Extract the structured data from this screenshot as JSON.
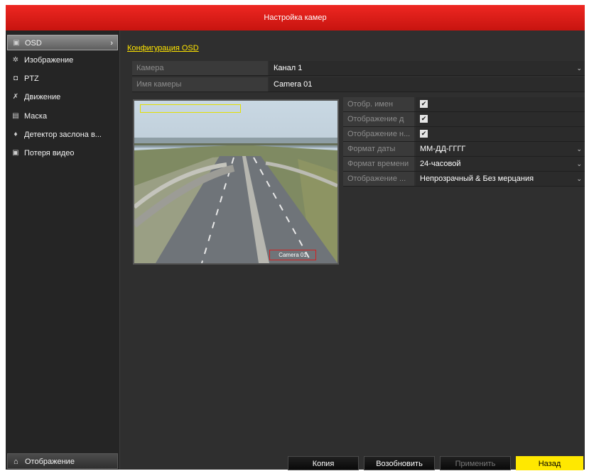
{
  "window": {
    "title": "Настройка камер"
  },
  "sidebar": {
    "items": [
      {
        "label": "OSD",
        "icon": "osd-icon",
        "glyph": "▣",
        "active": true
      },
      {
        "label": "Изображение",
        "icon": "image-icon",
        "glyph": "✲"
      },
      {
        "label": "PTZ",
        "icon": "ptz-icon",
        "glyph": "◘"
      },
      {
        "label": "Движение",
        "icon": "motion-icon",
        "glyph": "✗"
      },
      {
        "label": "Маска",
        "icon": "mask-icon",
        "glyph": "▤"
      },
      {
        "label": "Детектор заслона в...",
        "icon": "tamper-icon",
        "glyph": "♦"
      },
      {
        "label": "Потеря видео",
        "icon": "video-loss-icon",
        "glyph": "▣"
      }
    ],
    "arrow": "›",
    "bottom_nav": {
      "label": "Отображение",
      "icon": "home-icon",
      "glyph": "⌂"
    }
  },
  "main": {
    "section_title": "Конфигурация OSD",
    "camera": {
      "label": "Камера",
      "value": "Канал 1"
    },
    "camera_name": {
      "label": "Имя камеры",
      "value": "Camera 01"
    },
    "options": [
      {
        "label": "Отобр. имен",
        "checked": true,
        "check_glyph": "✔"
      },
      {
        "label": "Отображение д",
        "checked": true,
        "check_glyph": "✔"
      },
      {
        "label": "Отображение н...",
        "checked": true,
        "check_glyph": "✔"
      }
    ],
    "date_format": {
      "label": "Формат даты",
      "value": "ММ-ДД-ГГГГ"
    },
    "time_format": {
      "label": "Формат времени",
      "value": "24-часовой"
    },
    "display_mode": {
      "label": "Отображение ...",
      "value": "Непрозрачный & Без мерцания"
    },
    "dropdown_glyph": "⌄",
    "preview": {
      "osd_text": "Camera 01"
    }
  },
  "buttons": {
    "copy": "Копия",
    "refresh": "Возобновить",
    "apply": "Применить",
    "back": "Назад"
  },
  "colors": {
    "title_bar": "#e01f1a",
    "accent_yellow": "#ffe800",
    "background": "#2f2f2f"
  }
}
